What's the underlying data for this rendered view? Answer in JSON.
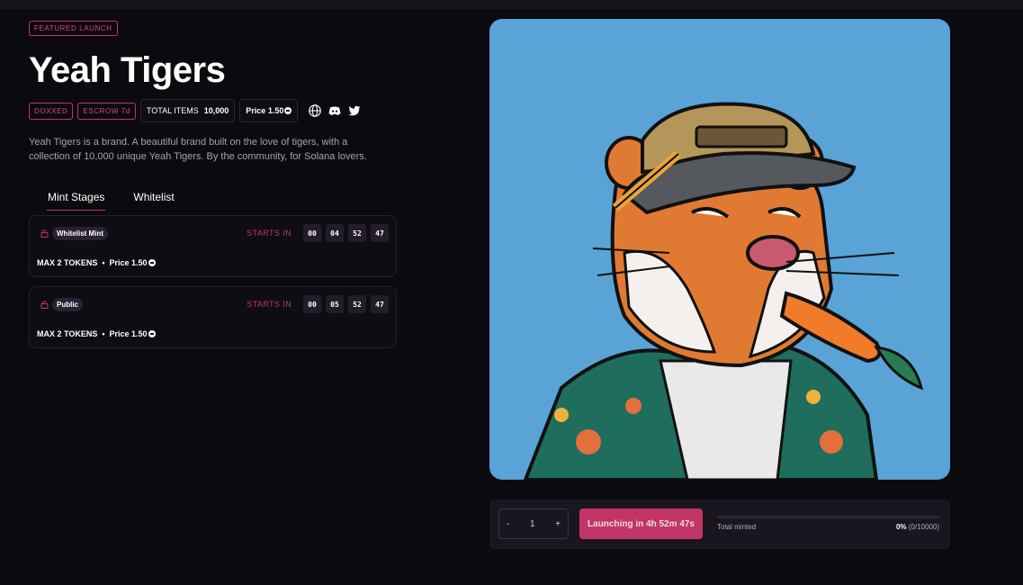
{
  "header": {
    "featured_badge": "FEATURED LAUNCH",
    "title": "Yeah Tigers"
  },
  "meta": {
    "doxxed": "DOXXED",
    "escrow": "ESCROW 7d",
    "total_items_label": "TOTAL ITEMS",
    "total_items_value": "10,000",
    "price_label": "Price 1.50",
    "icons": [
      "globe-icon",
      "discord-icon",
      "twitter-icon"
    ]
  },
  "description": "Yeah Tigers is a brand. A beautiful brand built on the love of tigers, with a collection of 10,000 unique Yeah Tigers. By the community, for Solana lovers.",
  "tabs": [
    {
      "label": "Mint Stages",
      "active": true
    },
    {
      "label": "Whitelist",
      "active": false
    }
  ],
  "stages": [
    {
      "name": "Whitelist Mint",
      "starts_label": "STARTS IN",
      "timer": [
        "00",
        "04",
        "52",
        "47"
      ],
      "max_tokens": "MAX 2 TOKENS",
      "price": "Price 1.50"
    },
    {
      "name": "Public",
      "starts_label": "STARTS IN",
      "timer": [
        "00",
        "05",
        "52",
        "47"
      ],
      "max_tokens": "MAX 2 TOKENS",
      "price": "Price 1.50"
    }
  ],
  "mint_panel": {
    "minus": "-",
    "quantity": "1",
    "plus": "+",
    "launch_button": "Launching in 4h 52m 47s",
    "total_minted_label": "Total minted",
    "percent": "0%",
    "count": "(0/10000)",
    "progress": 0
  },
  "colors": {
    "accent": "#c23567",
    "background": "#0b0a0e",
    "art_background": "#5aa3d6"
  }
}
